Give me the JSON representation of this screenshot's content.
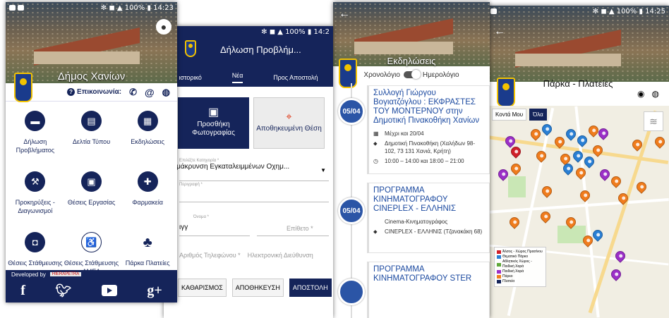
{
  "colors": {
    "primary_navy": "#15245a",
    "event_blue": "#2b55a6",
    "pin_orange": "#f07c1d",
    "pin_blue": "#2a7fd4",
    "pin_purple": "#9b2fc7",
    "pin_red": "#d0202a"
  },
  "screen1": {
    "status_time": "14:23",
    "status_battery": "100%",
    "city_title": "Δήμος Χανίων",
    "contact_label": "Επικοινωνία:",
    "tiles": [
      {
        "label": "Δήλωση Προβλήματος",
        "icon": "chat-icon"
      },
      {
        "label": "Δελτία Τύπου",
        "icon": "clipboard-icon"
      },
      {
        "label": "Εκδηλώσεις",
        "icon": "calendar-icon"
      },
      {
        "label": "Προκηρύξεις - Διαγωνισμοί",
        "icon": "gavel-icon"
      },
      {
        "label": "Θέσεις Εργασίας",
        "icon": "briefcase-icon"
      },
      {
        "label": "Φαρμακεία",
        "icon": "medical-kit-icon"
      },
      {
        "label": "Θέσεις Στάθμευσης",
        "icon": "car-icon"
      },
      {
        "label": "Θέσεις Στάθμευσης ΑΜΕΑ",
        "icon": "wheelchair-icon"
      },
      {
        "label": "Πάρκα Πλατείες",
        "icon": "tree-icon"
      }
    ],
    "developed_by": "Developed by",
    "developer_brand": "HIERAPETRA",
    "social": [
      "f",
      "twitter",
      "youtube",
      "g+"
    ]
  },
  "screen2": {
    "status_time": "14:2",
    "status_battery": "100%",
    "title": "Δήλωση Προβλήμ...",
    "tabs": [
      "ιστορικό",
      "Νέα",
      "Προς Αποστολή"
    ],
    "add_photo": "Προσθήκη Φωτογραφίας",
    "saved_location": "Αποθηκευμένη Θέση",
    "category_label": "Επιλέξτε Κατηγορία *",
    "category_value": "απομάκρυνση Εγκαταλειμμένων Οχημ...",
    "description_label": "Περιγραφή *",
    "first_name_label": "Όνομα *",
    "first_name_value": "ιγγ",
    "last_name_label": "Επίθετο *",
    "phone_label": "Αριθμός Τηλεφώνου *",
    "email_label": "Ηλεκτρονική Διεύθυνση",
    "buttons": [
      "ΚΑΘΑΡΙΣΜΟΣ",
      "ΑΠΟΘΗΚΕΥΣΗ",
      "ΑΠΟΣΤΟΛΗ"
    ]
  },
  "screen3": {
    "title": "Εκδηλώσεις",
    "toggle_left": "Χρονολόγιο",
    "toggle_right": "Ημερολόγιο",
    "events": [
      {
        "date": "05/04",
        "title": "Συλλογή Γιώργου Βογιατζόγλου : ΕΚΦΡΑΣΤΕΣ ΤΟΥ ΜΟΝΤΕΡΝΟΥ στην Δημοτική Πινακοθήκη Χανίων",
        "period": "Μέχρι και 20/04",
        "place": "Δημοτική Πινακοθήκη (Χαλήδων 98-102, 73 131 Χανιά, Κρήτη)",
        "hours": "10:00 – 14:00 και 18:00 – 21:00"
      },
      {
        "date": "05/04",
        "title": "ΠΡΟΓΡΑΜΜΑ ΚΙΝΗΜΑΤΟΓΡΑΦΟΥ CINEPLEX - ΕΛΛΗΝΙΣ",
        "category": "Cinema-Κινηματογράφος",
        "place": "CINEPLEX - ΕΛΛΗΝΙΣ (Τζανακάκη 68)"
      },
      {
        "date": "",
        "title": "ΠΡΟΓΡΑΜΜΑ ΚΙΝΗΜΑΤΟΓΡΑΦΟΥ STER"
      }
    ]
  },
  "screen4": {
    "status_time": "14:25",
    "status_battery": "100%",
    "title": "Πάρκα - Πλατείες",
    "filter_near": "Κοντά Μου",
    "filter_all": "Όλα",
    "legend": [
      {
        "label": "Άλσος - Χώρος Πρασίνου",
        "color": "#d0202a"
      },
      {
        "label": "Θεματικό Πάρκο",
        "color": "#2a7fd4"
      },
      {
        "label": "Αθλητικός Χώρος - Παιδική Χαρά",
        "color": "#5fa83a"
      },
      {
        "label": "Παιδική Χαρά",
        "color": "#9b2fc7"
      },
      {
        "label": "Πάρκο",
        "color": "#f07c1d"
      },
      {
        "label": "Πλατεία",
        "color": "#15245a"
      }
    ]
  }
}
